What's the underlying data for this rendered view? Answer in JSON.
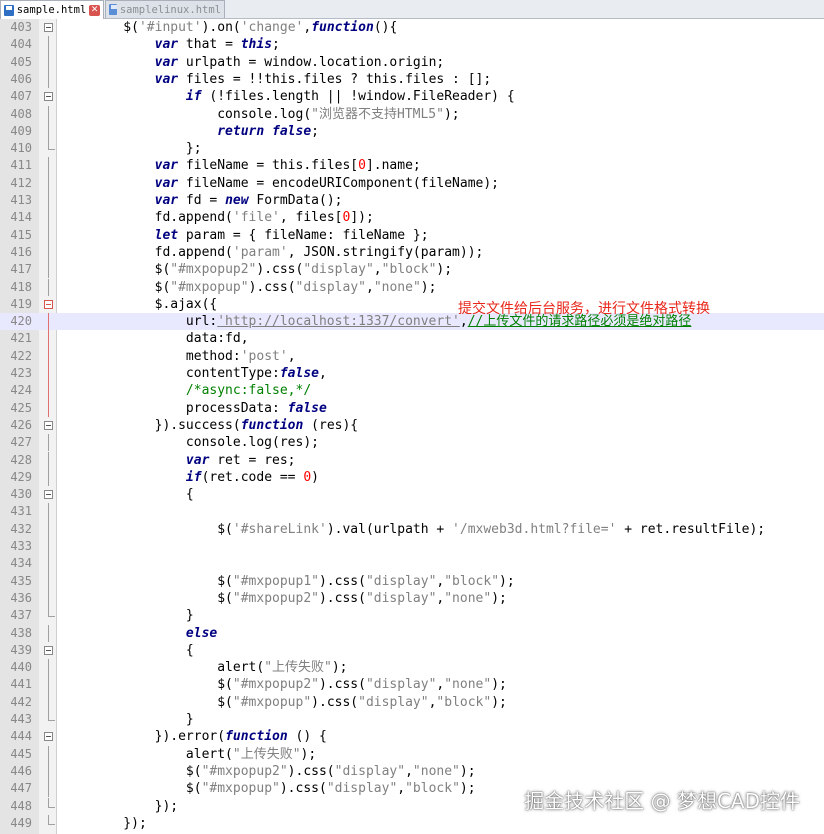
{
  "tabs": [
    {
      "label": "sample.html",
      "active": true,
      "icon": "saved-file-icon",
      "close": "✕"
    },
    {
      "label": "samplelinux.html",
      "active": false,
      "icon": "unsaved-file-icon"
    }
  ],
  "annotation": "提交文件给后台服务，进行文件格式转换",
  "watermark": "掘金技术社区 @ 梦想CAD控件",
  "colors": {
    "keyword": "#000080",
    "string": "#808080",
    "number": "#ff0000",
    "comment": "#008000",
    "annotation": "#e8261a"
  },
  "lines": [
    {
      "n": "403",
      "fold": "box",
      "tokens": [
        [
          "t",
          "    $("
        ],
        [
          "s",
          "'#input'"
        ],
        [
          "t",
          ")"
        ],
        [
          "t",
          ".on("
        ],
        [
          "s",
          "'change'"
        ],
        [
          "t",
          ","
        ],
        [
          "k",
          "function"
        ],
        [
          "t",
          "(){"
        ]
      ]
    },
    {
      "n": "404",
      "fold": "line",
      "tokens": [
        [
          "t",
          "        "
        ],
        [
          "k",
          "var"
        ],
        [
          "t",
          " that = "
        ],
        [
          "k",
          "this"
        ],
        [
          "t",
          ";"
        ]
      ]
    },
    {
      "n": "405",
      "fold": "line",
      "tokens": [
        [
          "t",
          "        "
        ],
        [
          "k",
          "var"
        ],
        [
          "t",
          " urlpath = window.location.origin;"
        ]
      ]
    },
    {
      "n": "406",
      "fold": "line",
      "tokens": [
        [
          "t",
          "        "
        ],
        [
          "k",
          "var"
        ],
        [
          "t",
          " files = !!this.files ? this.files : [];"
        ]
      ]
    },
    {
      "n": "407",
      "fold": "box",
      "tokens": [
        [
          "t",
          "            "
        ],
        [
          "k",
          "if"
        ],
        [
          "t",
          " (!files.length || !window.FileReader) {"
        ]
      ]
    },
    {
      "n": "408",
      "fold": "line",
      "tokens": [
        [
          "t",
          "                console.log("
        ],
        [
          "s",
          "\"浏览器不支持HTML5\""
        ],
        [
          "t",
          ");"
        ]
      ]
    },
    {
      "n": "409",
      "fold": "line",
      "tokens": [
        [
          "t",
          "                "
        ],
        [
          "k",
          "return"
        ],
        [
          "t",
          " "
        ],
        [
          "k",
          "false"
        ],
        [
          "t",
          ";"
        ]
      ]
    },
    {
      "n": "410",
      "fold": "end",
      "tokens": [
        [
          "t",
          "            };"
        ]
      ]
    },
    {
      "n": "411",
      "fold": "line",
      "tokens": [
        [
          "t",
          "        "
        ],
        [
          "k",
          "var"
        ],
        [
          "t",
          " fileName = this.files["
        ],
        [
          "n",
          "0"
        ],
        [
          "t",
          "].name;"
        ]
      ]
    },
    {
      "n": "412",
      "fold": "line",
      "tokens": [
        [
          "t",
          "        "
        ],
        [
          "k",
          "var"
        ],
        [
          "t",
          " fileName = encodeURIComponent(fileName);"
        ]
      ]
    },
    {
      "n": "413",
      "fold": "line",
      "tokens": [
        [
          "t",
          "        "
        ],
        [
          "k",
          "var"
        ],
        [
          "t",
          " fd = "
        ],
        [
          "k",
          "new"
        ],
        [
          "t",
          " FormData();"
        ]
      ]
    },
    {
      "n": "414",
      "fold": "line",
      "tokens": [
        [
          "t",
          "        fd.append("
        ],
        [
          "s",
          "'file'"
        ],
        [
          "t",
          ", files["
        ],
        [
          "n",
          "0"
        ],
        [
          "t",
          "]);"
        ]
      ]
    },
    {
      "n": "415",
      "fold": "line",
      "tokens": [
        [
          "t",
          "        "
        ],
        [
          "k",
          "let"
        ],
        [
          "t",
          " param = { fileName: fileName };"
        ]
      ]
    },
    {
      "n": "416",
      "fold": "line",
      "tokens": [
        [
          "t",
          "        fd.append("
        ],
        [
          "s",
          "'param'"
        ],
        [
          "t",
          ", JSON.stringify(param));"
        ]
      ]
    },
    {
      "n": "417",
      "fold": "line",
      "tokens": [
        [
          "t",
          "        $("
        ],
        [
          "s",
          "\"#mxpopup2\""
        ],
        [
          "t",
          ").css("
        ],
        [
          "s",
          "\"display\""
        ],
        [
          "t",
          ","
        ],
        [
          "s",
          "\"block\""
        ],
        [
          "t",
          ");"
        ]
      ]
    },
    {
      "n": "418",
      "fold": "line",
      "tokens": [
        [
          "t",
          "        $("
        ],
        [
          "s",
          "\"#mxpopup\""
        ],
        [
          "t",
          ").css("
        ],
        [
          "s",
          "\"display\""
        ],
        [
          "t",
          ","
        ],
        [
          "s",
          "\"none\""
        ],
        [
          "t",
          ");"
        ]
      ]
    },
    {
      "n": "419",
      "fold": "redbox",
      "tokens": [
        [
          "t",
          "        $.ajax({"
        ]
      ]
    },
    {
      "n": "420",
      "fold": "redline",
      "current": true,
      "tokens": [
        [
          "t",
          "            url:"
        ],
        [
          "u",
          "'http://localhost:1337/convert'"
        ],
        [
          "t",
          ","
        ],
        [
          "cu",
          "//上传文件的请求路径必须是绝对路径"
        ]
      ]
    },
    {
      "n": "421",
      "fold": "redline",
      "tokens": [
        [
          "t",
          "            data:fd,"
        ]
      ]
    },
    {
      "n": "422",
      "fold": "redline",
      "tokens": [
        [
          "t",
          "            method:"
        ],
        [
          "s",
          "'post'"
        ],
        [
          "t",
          ","
        ]
      ]
    },
    {
      "n": "423",
      "fold": "redline",
      "tokens": [
        [
          "t",
          "            contentType:"
        ],
        [
          "k",
          "false"
        ],
        [
          "t",
          ","
        ]
      ]
    },
    {
      "n": "424",
      "fold": "redline",
      "tokens": [
        [
          "t",
          "            "
        ],
        [
          "c",
          "/*async:false,*/"
        ]
      ]
    },
    {
      "n": "425",
      "fold": "redline",
      "tokens": [
        [
          "t",
          "            processData: "
        ],
        [
          "k",
          "false"
        ]
      ]
    },
    {
      "n": "426",
      "fold": "box",
      "tokens": [
        [
          "t",
          "        }).success("
        ],
        [
          "k",
          "function"
        ],
        [
          "t",
          " (res){"
        ]
      ]
    },
    {
      "n": "427",
      "fold": "line",
      "tokens": [
        [
          "t",
          "            console.log(res);"
        ]
      ]
    },
    {
      "n": "428",
      "fold": "line",
      "tokens": [
        [
          "t",
          "            "
        ],
        [
          "k",
          "var"
        ],
        [
          "t",
          " ret = res;"
        ]
      ]
    },
    {
      "n": "429",
      "fold": "line",
      "tokens": [
        [
          "t",
          "            "
        ],
        [
          "k",
          "if"
        ],
        [
          "t",
          "(ret.code == "
        ],
        [
          "n",
          "0"
        ],
        [
          "t",
          ")"
        ]
      ]
    },
    {
      "n": "430",
      "fold": "box",
      "tokens": [
        [
          "t",
          "            {"
        ]
      ]
    },
    {
      "n": "431",
      "fold": "line",
      "tokens": [
        [
          "t",
          ""
        ]
      ]
    },
    {
      "n": "432",
      "fold": "line",
      "tokens": [
        [
          "t",
          "                $("
        ],
        [
          "s",
          "'#shareLink'"
        ],
        [
          "t",
          ").val(urlpath + "
        ],
        [
          "s",
          "'/mxweb3d.html?file='"
        ],
        [
          "t",
          " + ret.resultFile);"
        ]
      ]
    },
    {
      "n": "433",
      "fold": "line",
      "tokens": [
        [
          "t",
          ""
        ]
      ]
    },
    {
      "n": "434",
      "fold": "line",
      "tokens": [
        [
          "t",
          ""
        ]
      ]
    },
    {
      "n": "435",
      "fold": "line",
      "tokens": [
        [
          "t",
          "                $("
        ],
        [
          "s",
          "\"#mxpopup1\""
        ],
        [
          "t",
          ").css("
        ],
        [
          "s",
          "\"display\""
        ],
        [
          "t",
          ","
        ],
        [
          "s",
          "\"block\""
        ],
        [
          "t",
          ");"
        ]
      ]
    },
    {
      "n": "436",
      "fold": "line",
      "tokens": [
        [
          "t",
          "                $("
        ],
        [
          "s",
          "\"#mxpopup2\""
        ],
        [
          "t",
          ").css("
        ],
        [
          "s",
          "\"display\""
        ],
        [
          "t",
          ","
        ],
        [
          "s",
          "\"none\""
        ],
        [
          "t",
          ");"
        ]
      ]
    },
    {
      "n": "437",
      "fold": "end",
      "tokens": [
        [
          "t",
          "            }"
        ]
      ]
    },
    {
      "n": "438",
      "fold": "line",
      "tokens": [
        [
          "t",
          "            "
        ],
        [
          "k",
          "else"
        ]
      ]
    },
    {
      "n": "439",
      "fold": "box",
      "tokens": [
        [
          "t",
          "            {"
        ]
      ]
    },
    {
      "n": "440",
      "fold": "line",
      "tokens": [
        [
          "t",
          "                alert("
        ],
        [
          "s",
          "\"上传失败\""
        ],
        [
          "t",
          ");"
        ]
      ]
    },
    {
      "n": "441",
      "fold": "line",
      "tokens": [
        [
          "t",
          "                $("
        ],
        [
          "s",
          "\"#mxpopup2\""
        ],
        [
          "t",
          ").css("
        ],
        [
          "s",
          "\"display\""
        ],
        [
          "t",
          ","
        ],
        [
          "s",
          "\"none\""
        ],
        [
          "t",
          ");"
        ]
      ]
    },
    {
      "n": "442",
      "fold": "line",
      "tokens": [
        [
          "t",
          "                $("
        ],
        [
          "s",
          "\"#mxpopup\""
        ],
        [
          "t",
          ").css("
        ],
        [
          "s",
          "\"display\""
        ],
        [
          "t",
          ","
        ],
        [
          "s",
          "\"block\""
        ],
        [
          "t",
          ");"
        ]
      ]
    },
    {
      "n": "443",
      "fold": "end",
      "tokens": [
        [
          "t",
          "            }"
        ]
      ]
    },
    {
      "n": "444",
      "fold": "box",
      "tokens": [
        [
          "t",
          "        }).error("
        ],
        [
          "k",
          "function"
        ],
        [
          "t",
          " () {"
        ]
      ]
    },
    {
      "n": "445",
      "fold": "line",
      "tokens": [
        [
          "t",
          "            alert("
        ],
        [
          "s",
          "\"上传失败\""
        ],
        [
          "t",
          ");"
        ]
      ]
    },
    {
      "n": "446",
      "fold": "line",
      "tokens": [
        [
          "t",
          "            $("
        ],
        [
          "s",
          "\"#mxpopup2\""
        ],
        [
          "t",
          ").css("
        ],
        [
          "s",
          "\"display\""
        ],
        [
          "t",
          ","
        ],
        [
          "s",
          "\"none\""
        ],
        [
          "t",
          ");"
        ]
      ]
    },
    {
      "n": "447",
      "fold": "line",
      "tokens": [
        [
          "t",
          "            $("
        ],
        [
          "s",
          "\"#mxpopup\""
        ],
        [
          "t",
          ").css("
        ],
        [
          "s",
          "\"display\""
        ],
        [
          "t",
          ","
        ],
        [
          "s",
          "\"block\""
        ],
        [
          "t",
          ");"
        ]
      ]
    },
    {
      "n": "448",
      "fold": "end",
      "tokens": [
        [
          "t",
          "        });"
        ]
      ]
    },
    {
      "n": "449",
      "fold": "end",
      "tokens": [
        [
          "t",
          "    });"
        ]
      ]
    }
  ]
}
